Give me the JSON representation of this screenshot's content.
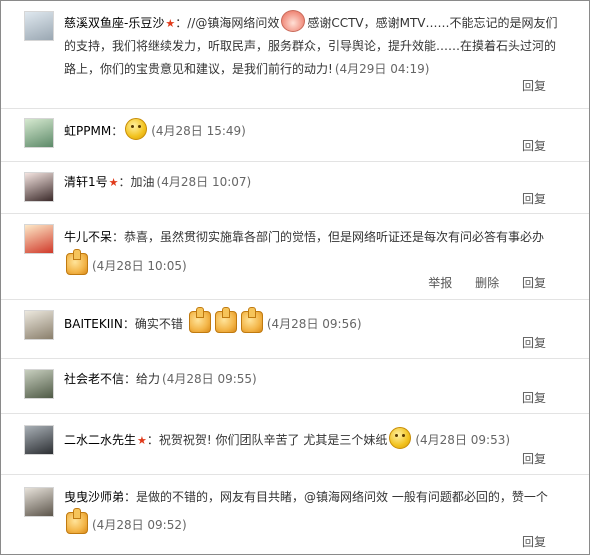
{
  "actions": {
    "reply": "回复",
    "report": "举报",
    "delete": "删除"
  },
  "comments": [
    {
      "user": "慈溪双鱼座-乐豆沙",
      "text_a": "//@镇海网络问效",
      "text_b": "感谢CCTV，感谢MTV……不能忘记的是网友们的支持，我们将继续发力，听取民声，服务群众，引导舆论，提升效能……在摸着石头过河的路上，你们的宝贵意见和建议，是我们前行的动力!",
      "time": "(4月29日 04:19)"
    },
    {
      "user": "虹PPMM",
      "text": "",
      "time": "(4月28日 15:49)"
    },
    {
      "user": "清轩1号",
      "text": "加油",
      "time": "(4月28日 10:07)"
    },
    {
      "user": "牛儿不呆",
      "text": "恭喜，虽然贯彻实施靠各部门的觉悟，但是网络听证还是每次有问必答有事必办",
      "time": "(4月28日 10:05)"
    },
    {
      "user": "BAITEKIIN",
      "text": "确实不错",
      "time": "(4月28日 09:56)"
    },
    {
      "user": "社会老不信",
      "text": "给力",
      "time": "(4月28日 09:55)"
    },
    {
      "user": "二水二水先生",
      "text": "祝贺祝贺! 你们团队辛苦了 尤其是三个妹纸",
      "time": "(4月28日 09:53)"
    },
    {
      "user": "曳曳沙师弟",
      "text": "是做的不错的，网友有目共睹，@镇海网络问效 一般有问题都必回的，赞一个",
      "time": "(4月28日 09:52)"
    }
  ]
}
